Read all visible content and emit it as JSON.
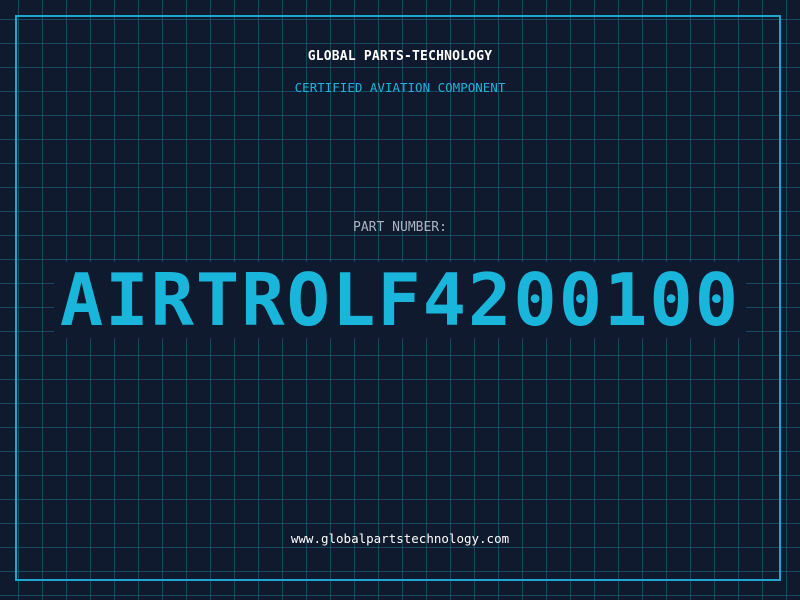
{
  "header": {
    "company": "GLOBAL PARTS-TECHNOLOGY",
    "subtitle": "CERTIFIED AVIATION COMPONENT"
  },
  "part": {
    "label": "PART NUMBER:",
    "number": "AIRTROLF4200100"
  },
  "footer": {
    "website": "www.globalpartstechnology.com"
  },
  "colors": {
    "background": "#101a2e",
    "grid": "#1e6e8c",
    "accent": "#1ea6cf",
    "text": "#ffffff"
  }
}
